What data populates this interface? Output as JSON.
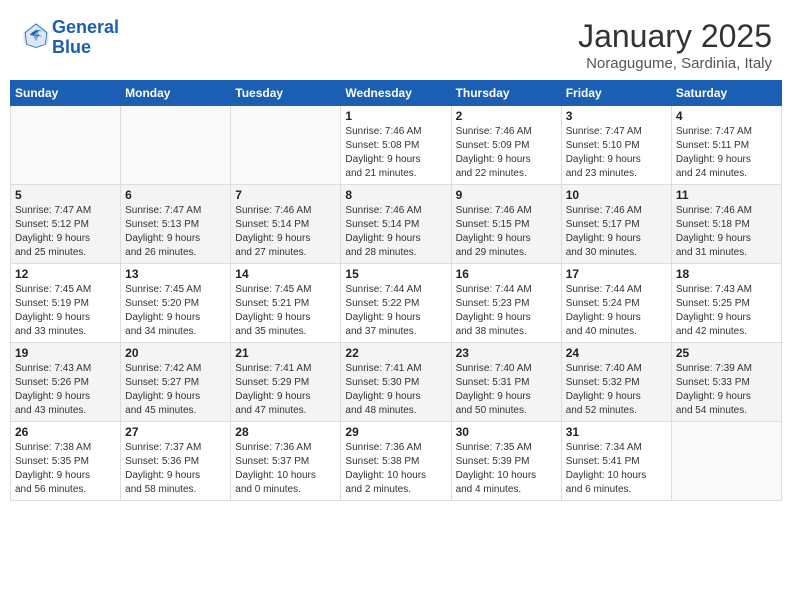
{
  "header": {
    "logo_line1": "General",
    "logo_line2": "Blue",
    "month": "January 2025",
    "location": "Noragugume, Sardinia, Italy"
  },
  "weekdays": [
    "Sunday",
    "Monday",
    "Tuesday",
    "Wednesday",
    "Thursday",
    "Friday",
    "Saturday"
  ],
  "weeks": [
    [
      {
        "day": "",
        "info": ""
      },
      {
        "day": "",
        "info": ""
      },
      {
        "day": "",
        "info": ""
      },
      {
        "day": "1",
        "info": "Sunrise: 7:46 AM\nSunset: 5:08 PM\nDaylight: 9 hours\nand 21 minutes."
      },
      {
        "day": "2",
        "info": "Sunrise: 7:46 AM\nSunset: 5:09 PM\nDaylight: 9 hours\nand 22 minutes."
      },
      {
        "day": "3",
        "info": "Sunrise: 7:47 AM\nSunset: 5:10 PM\nDaylight: 9 hours\nand 23 minutes."
      },
      {
        "day": "4",
        "info": "Sunrise: 7:47 AM\nSunset: 5:11 PM\nDaylight: 9 hours\nand 24 minutes."
      }
    ],
    [
      {
        "day": "5",
        "info": "Sunrise: 7:47 AM\nSunset: 5:12 PM\nDaylight: 9 hours\nand 25 minutes."
      },
      {
        "day": "6",
        "info": "Sunrise: 7:47 AM\nSunset: 5:13 PM\nDaylight: 9 hours\nand 26 minutes."
      },
      {
        "day": "7",
        "info": "Sunrise: 7:46 AM\nSunset: 5:14 PM\nDaylight: 9 hours\nand 27 minutes."
      },
      {
        "day": "8",
        "info": "Sunrise: 7:46 AM\nSunset: 5:14 PM\nDaylight: 9 hours\nand 28 minutes."
      },
      {
        "day": "9",
        "info": "Sunrise: 7:46 AM\nSunset: 5:15 PM\nDaylight: 9 hours\nand 29 minutes."
      },
      {
        "day": "10",
        "info": "Sunrise: 7:46 AM\nSunset: 5:17 PM\nDaylight: 9 hours\nand 30 minutes."
      },
      {
        "day": "11",
        "info": "Sunrise: 7:46 AM\nSunset: 5:18 PM\nDaylight: 9 hours\nand 31 minutes."
      }
    ],
    [
      {
        "day": "12",
        "info": "Sunrise: 7:45 AM\nSunset: 5:19 PM\nDaylight: 9 hours\nand 33 minutes."
      },
      {
        "day": "13",
        "info": "Sunrise: 7:45 AM\nSunset: 5:20 PM\nDaylight: 9 hours\nand 34 minutes."
      },
      {
        "day": "14",
        "info": "Sunrise: 7:45 AM\nSunset: 5:21 PM\nDaylight: 9 hours\nand 35 minutes."
      },
      {
        "day": "15",
        "info": "Sunrise: 7:44 AM\nSunset: 5:22 PM\nDaylight: 9 hours\nand 37 minutes."
      },
      {
        "day": "16",
        "info": "Sunrise: 7:44 AM\nSunset: 5:23 PM\nDaylight: 9 hours\nand 38 minutes."
      },
      {
        "day": "17",
        "info": "Sunrise: 7:44 AM\nSunset: 5:24 PM\nDaylight: 9 hours\nand 40 minutes."
      },
      {
        "day": "18",
        "info": "Sunrise: 7:43 AM\nSunset: 5:25 PM\nDaylight: 9 hours\nand 42 minutes."
      }
    ],
    [
      {
        "day": "19",
        "info": "Sunrise: 7:43 AM\nSunset: 5:26 PM\nDaylight: 9 hours\nand 43 minutes."
      },
      {
        "day": "20",
        "info": "Sunrise: 7:42 AM\nSunset: 5:27 PM\nDaylight: 9 hours\nand 45 minutes."
      },
      {
        "day": "21",
        "info": "Sunrise: 7:41 AM\nSunset: 5:29 PM\nDaylight: 9 hours\nand 47 minutes."
      },
      {
        "day": "22",
        "info": "Sunrise: 7:41 AM\nSunset: 5:30 PM\nDaylight: 9 hours\nand 48 minutes."
      },
      {
        "day": "23",
        "info": "Sunrise: 7:40 AM\nSunset: 5:31 PM\nDaylight: 9 hours\nand 50 minutes."
      },
      {
        "day": "24",
        "info": "Sunrise: 7:40 AM\nSunset: 5:32 PM\nDaylight: 9 hours\nand 52 minutes."
      },
      {
        "day": "25",
        "info": "Sunrise: 7:39 AM\nSunset: 5:33 PM\nDaylight: 9 hours\nand 54 minutes."
      }
    ],
    [
      {
        "day": "26",
        "info": "Sunrise: 7:38 AM\nSunset: 5:35 PM\nDaylight: 9 hours\nand 56 minutes."
      },
      {
        "day": "27",
        "info": "Sunrise: 7:37 AM\nSunset: 5:36 PM\nDaylight: 9 hours\nand 58 minutes."
      },
      {
        "day": "28",
        "info": "Sunrise: 7:36 AM\nSunset: 5:37 PM\nDaylight: 10 hours\nand 0 minutes."
      },
      {
        "day": "29",
        "info": "Sunrise: 7:36 AM\nSunset: 5:38 PM\nDaylight: 10 hours\nand 2 minutes."
      },
      {
        "day": "30",
        "info": "Sunrise: 7:35 AM\nSunset: 5:39 PM\nDaylight: 10 hours\nand 4 minutes."
      },
      {
        "day": "31",
        "info": "Sunrise: 7:34 AM\nSunset: 5:41 PM\nDaylight: 10 hours\nand 6 minutes."
      },
      {
        "day": "",
        "info": ""
      }
    ]
  ]
}
